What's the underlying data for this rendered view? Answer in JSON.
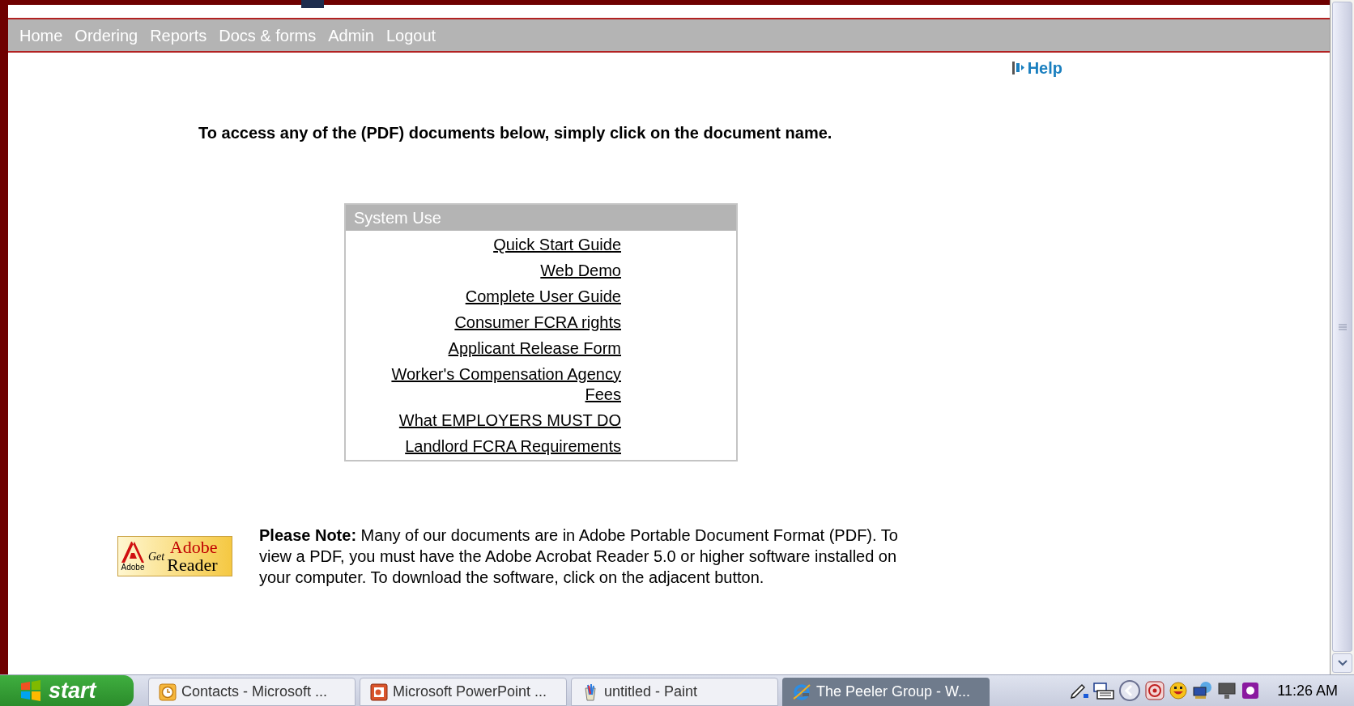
{
  "nav": {
    "items": [
      {
        "label": "Home"
      },
      {
        "label": "Ordering"
      },
      {
        "label": "Reports"
      },
      {
        "label": "Docs & forms"
      },
      {
        "label": "Admin"
      },
      {
        "label": "Logout"
      }
    ]
  },
  "help": {
    "label": "Help"
  },
  "heading": "To access any of the (PDF) documents below, simply click on the document name.",
  "documents": {
    "title": "System Use",
    "links": [
      "Quick Start Guide",
      "Web Demo",
      "Complete User Guide",
      "Consumer FCRA rights",
      "Applicant Release Form",
      "Worker's Compensation Agency Fees",
      "What EMPLOYERS MUST DO",
      "Landlord FCRA Requirements"
    ]
  },
  "note": {
    "text": "**Please Note:** Many of our documents are in Adobe Portable Document Format (PDF). To view a PDF, you must have the Adobe Acrobat Reader 5.0 or higher software installed on your computer. To download the software, click on the adjacent button.",
    "badge": {
      "maker": "Adobe",
      "verb": "Get",
      "brand": "Adobe",
      "product": "Reader"
    }
  },
  "taskbar": {
    "start": "start",
    "tasks": [
      {
        "label": "Contacts - Microsoft ...",
        "kind": "clock",
        "selected": false
      },
      {
        "label": "Microsoft PowerPoint ...",
        "kind": "slides",
        "selected": false
      },
      {
        "label": "untitled - Paint",
        "kind": "paint",
        "selected": false
      },
      {
        "label": "The Peeler Group - W...",
        "kind": "browser",
        "selected": true
      }
    ],
    "clock": "11:26 AM"
  }
}
